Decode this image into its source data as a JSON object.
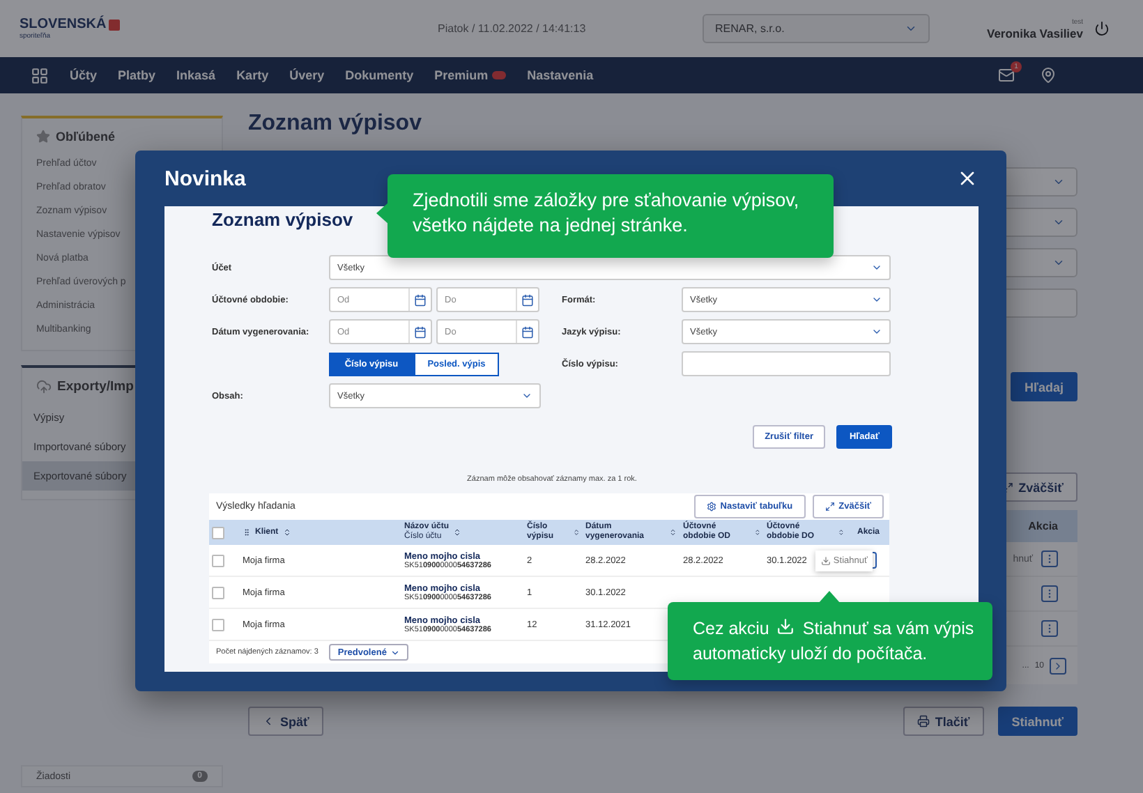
{
  "header": {
    "logo_name": "SLOVENSKÁ",
    "logo_sub": "sporiteľňa",
    "datetime": "Piatok / 11.02.2022 / 14:41:13",
    "company_select": "RENAR, s.r.o.",
    "user_role": "test",
    "user_name": "Veronika Vasiliev",
    "mail_badge": "1"
  },
  "nav": [
    {
      "label": "Účty",
      "kind": "link"
    },
    {
      "label": "Platby",
      "kind": "link"
    },
    {
      "label": "Inkasá",
      "kind": "link"
    },
    {
      "label": "Karty",
      "kind": "link"
    },
    {
      "label": "Úvery",
      "kind": "link"
    },
    {
      "label": "Dokumenty",
      "kind": "link"
    },
    {
      "label": "Premium",
      "kind": "toggle"
    },
    {
      "label": "Nastavenia",
      "kind": "link"
    }
  ],
  "sidebar": {
    "favorites": {
      "title": "Obľúbené",
      "items": [
        "Prehľad účtov",
        "Prehľad obratov",
        "Zoznam výpisov",
        "Nastavenie výpisov",
        "Nová platba",
        "Prehľad úverových p",
        "Administrácia",
        "Multibanking"
      ]
    },
    "exports": {
      "title": "Exporty/Imp",
      "items": [
        {
          "label": "Výpisy",
          "selected": false
        },
        {
          "label": "Importované súbory",
          "selected": false
        },
        {
          "label": "Exportované súbory",
          "selected": true
        }
      ]
    },
    "requests": {
      "label": "Žiadosti",
      "count": "0"
    }
  },
  "main": {
    "title": "Zoznam výpisov",
    "fields": [
      {
        "kind": "select"
      },
      {
        "kind": "select"
      },
      {
        "kind": "select"
      },
      {
        "kind": "input"
      }
    ],
    "search_button": "Hľadaj",
    "expand_button": "Zväčšiť",
    "table_column": "Akcia",
    "rows": [
      {
        "kind": "download",
        "action": "hnuť"
      },
      {
        "kind": "menu"
      },
      {
        "kind": "menu"
      }
    ],
    "pagination": {
      "ellipsis": "...",
      "last": "10"
    },
    "back_button": "Späť",
    "print_button": "Tlačiť",
    "download_button": "Stiahnuť"
  },
  "modal": {
    "title": "Novinka",
    "page": {
      "title": "Zoznam výpisov",
      "account": {
        "label": "Účet",
        "value": "Všetky"
      },
      "period": {
        "label": "Účtovné obdobie:",
        "from": "Od",
        "to": "Do"
      },
      "generated": {
        "label": "Dátum vygenerovania:",
        "from": "Od",
        "to": "Do"
      },
      "format": {
        "label": "Formát:",
        "value": "Všetky"
      },
      "language": {
        "label": "Jazyk výpisu:",
        "value": "Všetky"
      },
      "number": {
        "label": "Číslo výpisu:"
      },
      "toggle": [
        {
          "label": "Číslo výpisu",
          "selected": true
        },
        {
          "label": "Posled. výpis",
          "selected": false
        }
      ],
      "content": {
        "label": "Obsah:",
        "value": "Všetky"
      },
      "clear_button": "Zrušiť filter",
      "search_button": "Hľadať",
      "note": "Záznam môže obsahovať záznamy max. za 1 rok.",
      "results": {
        "title": "Výsledky hľadania",
        "settings_button": "Nastaviť tabuľku",
        "expand_button": "Zväčšiť",
        "select_all": false,
        "columns": [
          {
            "label": "Klient"
          },
          {
            "label": "Názov účtu",
            "sub": "Číslo účtu"
          },
          {
            "label": "Číslo výpisu"
          },
          {
            "label": "Dátum vygenerovania"
          },
          {
            "label": "Účtovné obdobie OD"
          },
          {
            "label": "Účtovné obdobie DO"
          },
          {
            "label": "Akcia"
          }
        ],
        "rows": [
          {
            "checked": false,
            "client": "Moja firma",
            "name": "Meno mojho cisla",
            "iban": "SK51**0900**0000**54637286**",
            "number": "2",
            "generated": "28.2.2022",
            "from": "28.2.2022",
            "to": "30.1.2022",
            "action": "Stiahnuť"
          },
          {
            "checked": false,
            "client": "Moja firma",
            "name": "Meno mojho cisla",
            "iban": "SK51**0900**0000**54637286**",
            "number": "1",
            "generated": "30.1.2022"
          },
          {
            "checked": false,
            "client": "Moja firma",
            "name": "Meno mojho cisla",
            "iban": "SK51**0900**0000**54637286**",
            "number": "12",
            "generated": "31.12.2021"
          }
        ],
        "count": "Počet nájdených záznamov: 3",
        "view_select": "Predvolené"
      }
    }
  },
  "tooltips": [
    {
      "kind": "left",
      "text": "Zjednotili sme záložky pre sťahovanie výpisov, všetko nájdete na jednej stránke."
    },
    {
      "kind": "up",
      "before": "Cez akciu",
      "after": "Stiahnuť sa vám výpis",
      "line2": "automaticky uloží do počítača."
    }
  ]
}
